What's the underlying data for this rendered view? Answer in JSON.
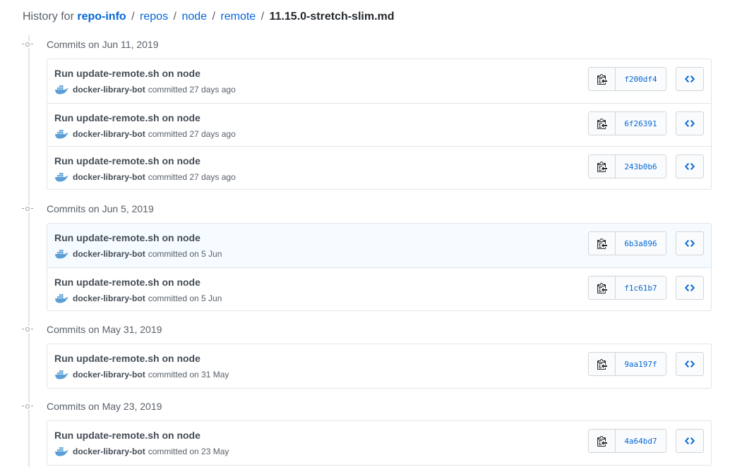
{
  "breadcrumb": {
    "prefix": "History for",
    "repo": "repo-info",
    "parts": [
      "repos",
      "node",
      "remote"
    ],
    "file": "11.15.0-stretch-slim.md",
    "separator": "/"
  },
  "groups": [
    {
      "title": "Commits on Jun 11, 2019",
      "commits": [
        {
          "title": "Run update-remote.sh on node",
          "author": "docker-library-bot",
          "when": "committed 27 days ago",
          "sha": "f200df4"
        },
        {
          "title": "Run update-remote.sh on node",
          "author": "docker-library-bot",
          "when": "committed 27 days ago",
          "sha": "6f26391"
        },
        {
          "title": "Run update-remote.sh on node",
          "author": "docker-library-bot",
          "when": "committed 27 days ago",
          "sha": "243b0b6"
        }
      ]
    },
    {
      "title": "Commits on Jun 5, 2019",
      "commits": [
        {
          "title": "Run update-remote.sh on node",
          "author": "docker-library-bot",
          "when": "committed on 5 Jun",
          "sha": "6b3a896"
        },
        {
          "title": "Run update-remote.sh on node",
          "author": "docker-library-bot",
          "when": "committed on 5 Jun",
          "sha": "f1c61b7"
        }
      ]
    },
    {
      "title": "Commits on May 31, 2019",
      "commits": [
        {
          "title": "Run update-remote.sh on node",
          "author": "docker-library-bot",
          "when": "committed on 31 May",
          "sha": "9aa197f"
        }
      ]
    },
    {
      "title": "Commits on May 23, 2019",
      "commits": [
        {
          "title": "Run update-remote.sh on node",
          "author": "docker-library-bot",
          "when": "committed on 23 May",
          "sha": "4a64bd7"
        }
      ]
    }
  ],
  "icons": {
    "copy": "clipboard-icon",
    "browse": "code-icon",
    "avatar": "docker-whale-icon",
    "timeline": "commit-node-icon"
  },
  "colors": {
    "link": "#0366d6",
    "border": "#e1e4e8",
    "avatar": "#5b9fd6"
  }
}
